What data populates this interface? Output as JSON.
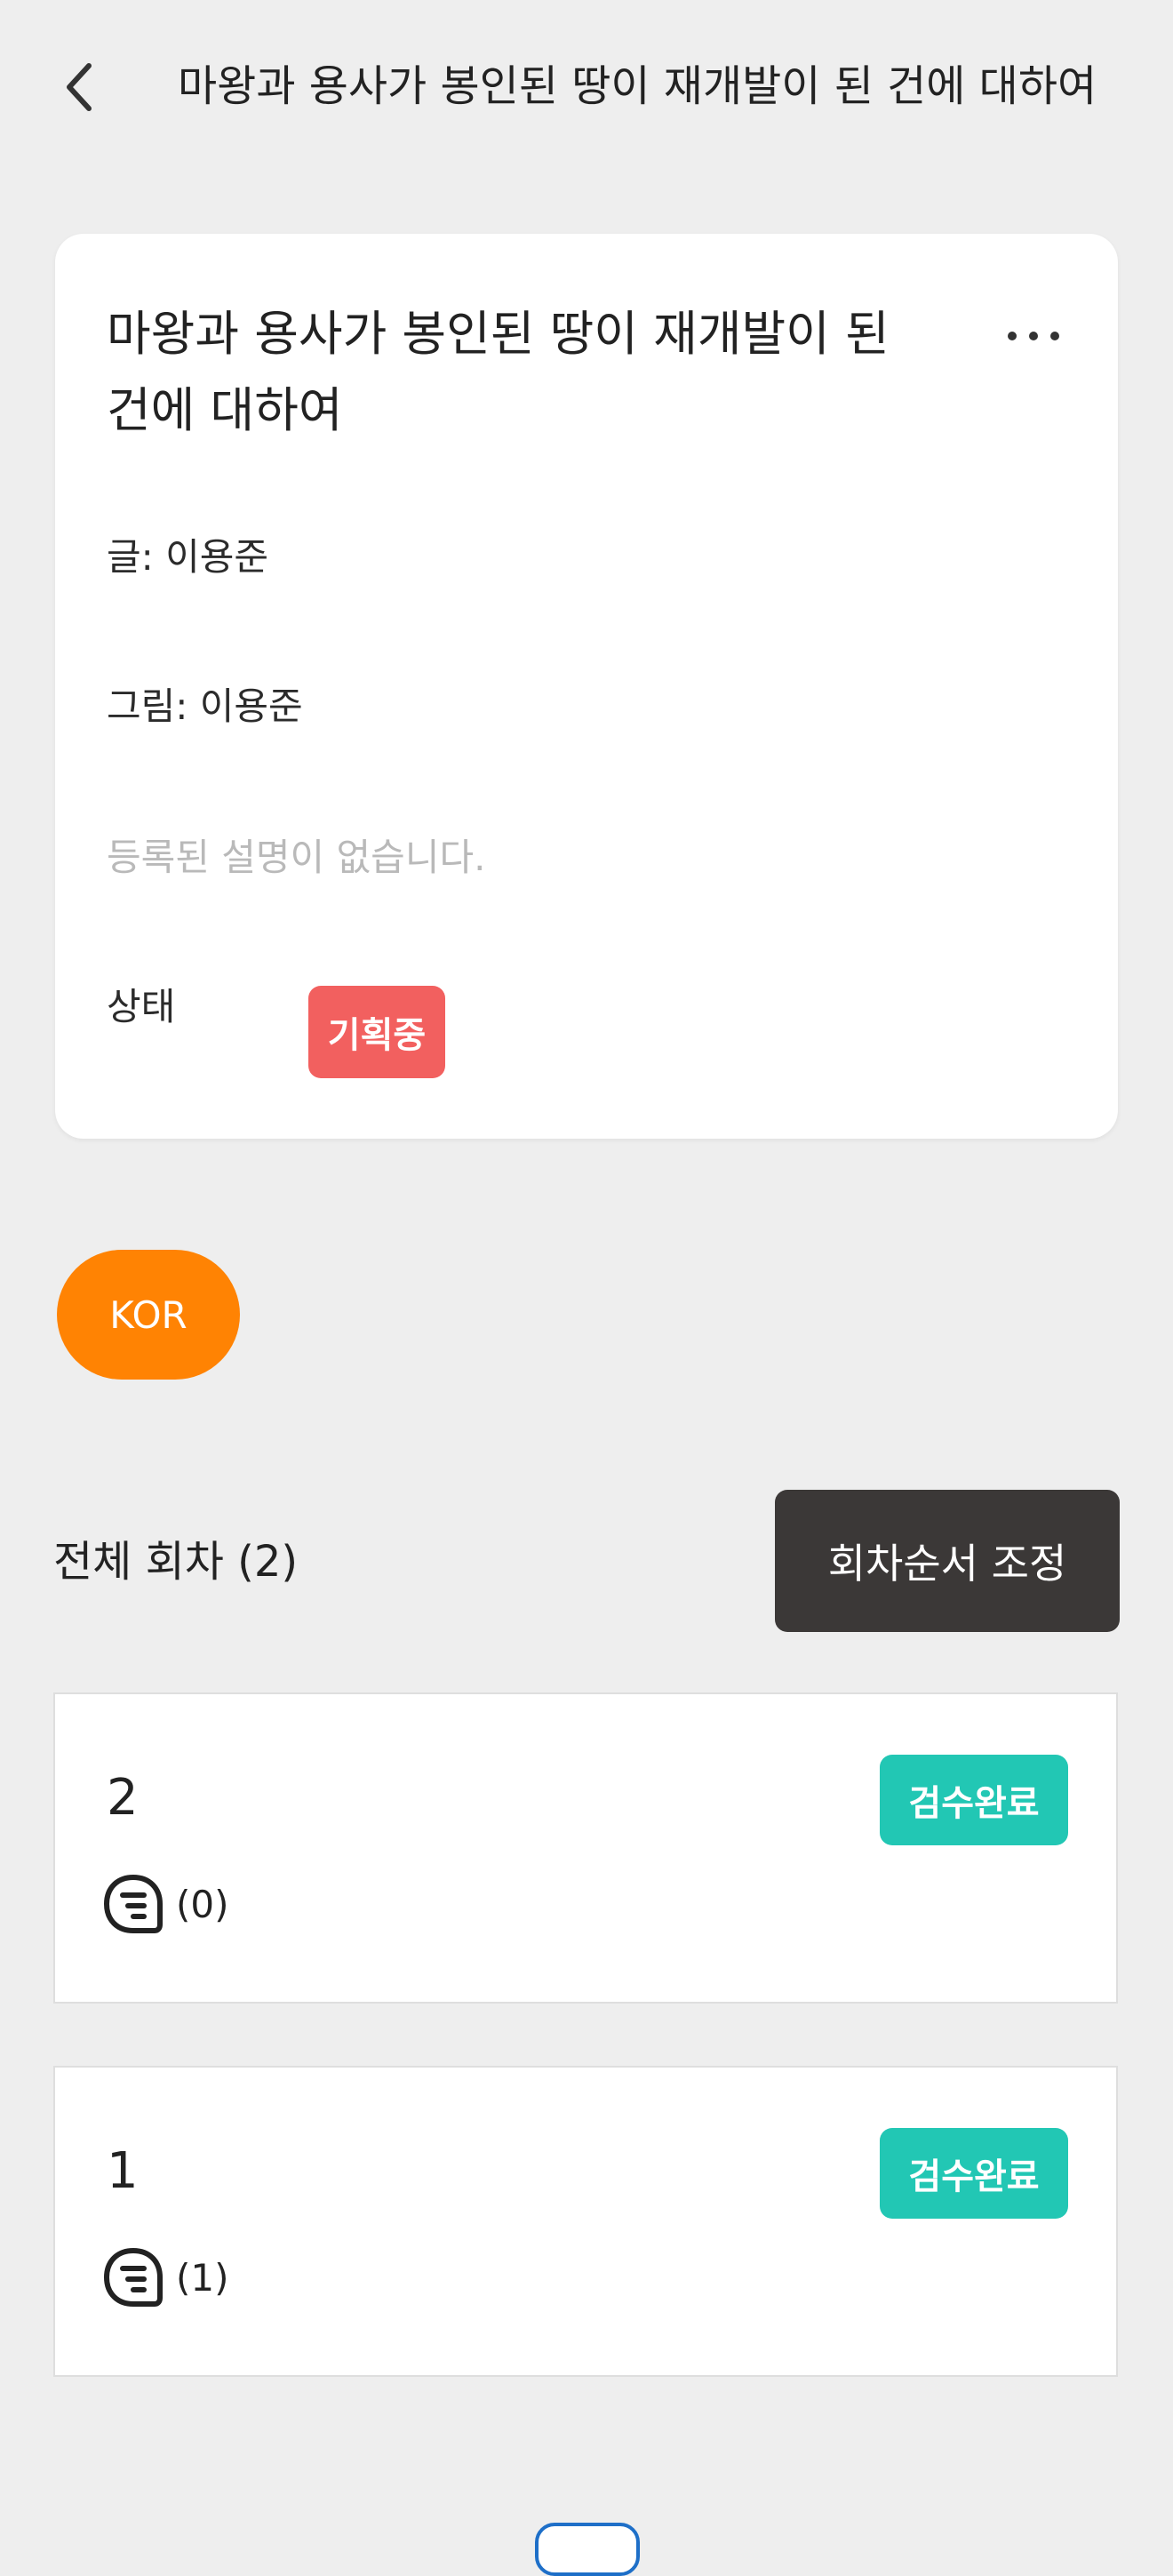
{
  "topbar": {
    "title": "마왕과 용사가 봉인된 땅이 재개발이 된 건에 대하여"
  },
  "series": {
    "title": "마왕과 용사가 봉인된 땅이 재개발이 된 건에 대하여",
    "writer": "글: 이용준",
    "artist": "그림: 이용준",
    "description": "등록된 설명이 없습니다.",
    "status_label": "상태",
    "status_value": "기획중",
    "status_color": "#f2605f"
  },
  "language": {
    "selected": "KOR",
    "color": "#ff8303"
  },
  "episodes": {
    "header": "전체 회차 (2)",
    "reorder_label": "회차순서 조정",
    "items": [
      {
        "number": "2",
        "status": "검수완료",
        "comments": "(0)"
      },
      {
        "number": "1",
        "status": "검수완료",
        "comments": "(1)"
      }
    ],
    "badge_color": "#22c7b4"
  },
  "icons": {
    "back": "chevron-left-icon",
    "more": "more-horizontal-icon",
    "comment": "comment-bubble-icon"
  }
}
